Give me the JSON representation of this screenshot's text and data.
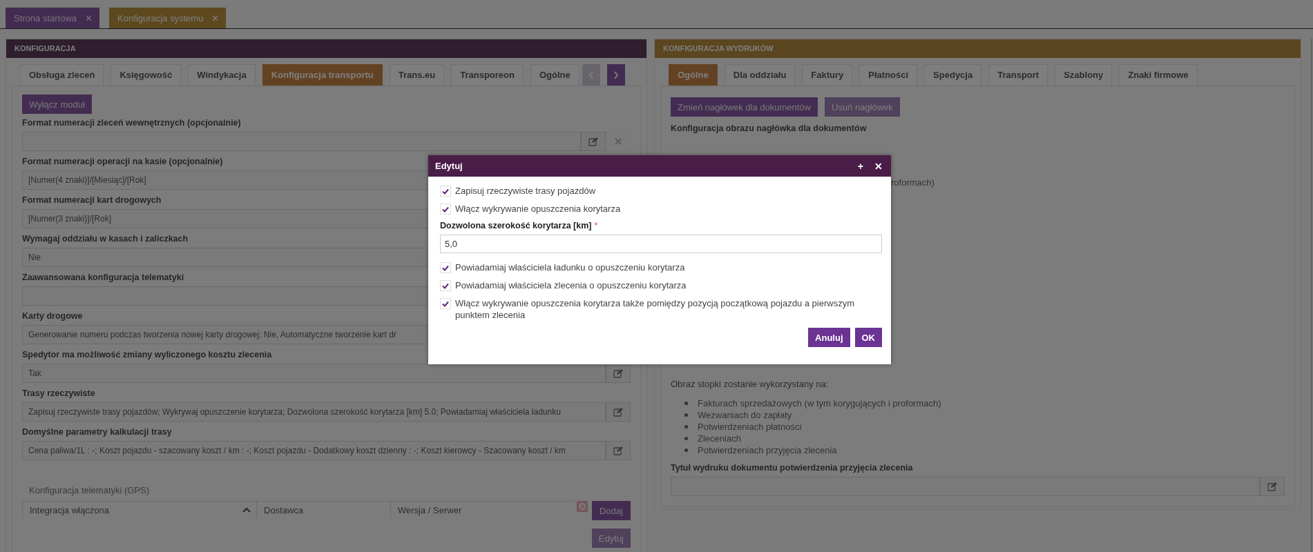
{
  "top_tabs": [
    {
      "label": "Strona startowa",
      "close": "✕",
      "selected": false
    },
    {
      "label": "Konfiguracja systemu",
      "close": "✕",
      "selected": true
    }
  ],
  "left_panel": {
    "title": "KONFIGURACJA",
    "tabs": [
      {
        "label": "Obsługa zleceń",
        "selected": false
      },
      {
        "label": "Księgowość",
        "selected": false
      },
      {
        "label": "Windykacja",
        "selected": false
      },
      {
        "label": "Konfiguracja transportu",
        "selected": true
      },
      {
        "label": "Trans.eu",
        "selected": false
      },
      {
        "label": "Transporeon",
        "selected": false
      },
      {
        "label": "Ogólne",
        "selected": false
      }
    ],
    "module_button": "Wyłącz moduł",
    "fields": [
      {
        "label": "Format numeracji zleceń wewnętrznych (opcjonalnie)",
        "editable": true,
        "clearable": true
      },
      {
        "label": "Format numeracji operacji na kasie (opcjonalnie)",
        "value": "[Numer(4 znaki)]/[Miesiąc]/[Rok]"
      },
      {
        "label": "Format numeracji kart drogowych",
        "value": "[Numer(3 znaki)]/[Rok]"
      },
      {
        "label": "Wymagaj oddziału w kasach i zaliczkach",
        "value": "Nie"
      },
      {
        "label": "Zaawansowana konfiguracja telematyki"
      },
      {
        "label": "Karty drogowe",
        "value": "Generowanie numeru podczas tworzenia nowej karty drogowej: Nie, Automatyczne tworzenie kart dr"
      },
      {
        "label": "Spedytor ma możliwość zmiany wyliczonego kosztu zlecenia",
        "value": "Tak",
        "editable": true
      },
      {
        "label": "Trasy rzeczywiste",
        "value": "Zapisuj rzeczywiste trasy pojazdów; Wykrywaj opuszczenie korytarza; Dozwolona szerokość korytarza [km] 5.0; Powiadamiaj właściciela ładunku",
        "editable": true
      },
      {
        "label": "Domyślne parametry kalkulacji trasy",
        "value": "Cena paliwa/1L : -; Koszt pojazdu - szacowany koszt / km : -; Koszt pojazdu - Dodatkowy koszt dzienny : -; Koszt kierowcy - Szacowany koszt / km",
        "editable": true
      }
    ],
    "telematics": {
      "title": "Konfiguracja telematyki (GPS)",
      "columns": [
        {
          "label": "Integracja włączona",
          "sorted": true
        },
        {
          "label": "Dostawca",
          "sorted": false
        },
        {
          "label": "Wersja / Serwer",
          "sorted": false
        }
      ],
      "buttons": [
        {
          "label": "Dodaj",
          "disabled": false
        },
        {
          "label": "Edytuj",
          "disabled": true
        }
      ]
    }
  },
  "right_panel": {
    "title": "KONFIGURACJA WYDRUKÓW",
    "tabs": [
      {
        "label": "Ogólne",
        "selected": true
      },
      {
        "label": "Dla oddziału",
        "selected": false
      },
      {
        "label": "Faktury",
        "selected": false
      },
      {
        "label": "Płatności",
        "selected": false
      },
      {
        "label": "Spedycja",
        "selected": false
      },
      {
        "label": "Transport",
        "selected": false
      },
      {
        "label": "Szablony",
        "selected": false
      },
      {
        "label": "Znaki firmowe",
        "selected": false
      }
    ],
    "buttons": [
      {
        "label": "Zmień nagłówek dla dokumentów",
        "disabled": false
      },
      {
        "label": "Usuń nagłówek",
        "disabled": true
      }
    ],
    "heading": "Konfiguracja obrazu nagłówka dla dokumentów",
    "fragment": "roformach)",
    "footer_intro": "Obraz stopki zostanie wykorzystany na:",
    "footer_items": [
      "Fakturach sprzedażowych (w tym korygujących i proformach)",
      "Wezwaniach do zapłaty",
      "Potwierdzeniach płatności",
      "Zleceniach",
      "Potwierdzeniach przyjęcia zlecenia"
    ],
    "field": {
      "label": "Tytuł wydruku dokumentu potwierdzenia przyjęcia zlecenia",
      "editable": true
    }
  },
  "dialog": {
    "title": "Edytuj",
    "maximize": "+",
    "close": "✕",
    "items": [
      {
        "kind": "checkbox",
        "label": "Zapisuj rzeczywiste trasy pojazdów",
        "checked": true
      },
      {
        "kind": "checkbox",
        "label": "Włącz wykrywanie opuszczenia korytarza",
        "checked": true
      },
      {
        "kind": "number",
        "label": "Dozwolona szerokość korytarza [km]",
        "required": true,
        "required_mark": "*",
        "value": "5,0"
      },
      {
        "kind": "checkbox",
        "label": "Powiadamiaj właściciela ładunku o opuszczeniu korytarza",
        "checked": true
      },
      {
        "kind": "checkbox",
        "label": "Powiadamiaj właściciela zlecenia o opuszczeniu korytarza",
        "checked": true
      },
      {
        "kind": "checkbox",
        "label": "Włącz wykrywanie opuszczenia korytarza także pomiędzy pozycją początkową pojazdu a pierwszym punktem zlecenia",
        "checked": true
      }
    ],
    "buttons": [
      "Anuluj",
      "OK"
    ]
  }
}
